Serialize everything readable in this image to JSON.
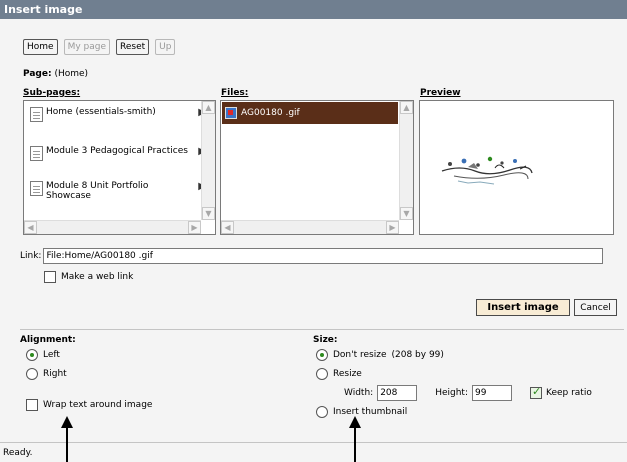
{
  "window": {
    "title": "Insert image"
  },
  "nav": {
    "home": "Home",
    "my_page": "My page",
    "reset": "Reset",
    "up": "Up"
  },
  "page": {
    "label": "Page:",
    "value": "(Home)"
  },
  "columns": {
    "subpages": "Sub-pages:",
    "files": "Files:",
    "preview": "Preview"
  },
  "subpages": [
    {
      "label": "Home (essentials-smith)"
    },
    {
      "label": "Module 3 Pedagogical Practices"
    },
    {
      "label": "Module 8 Unit Portfolio Showcase"
    }
  ],
  "files": {
    "selected": "AG00180 .gif"
  },
  "link": {
    "label": "Link:",
    "value": "File:Home/AG00180 .gif",
    "web_link_label": "Make a web link"
  },
  "buttons": {
    "insert": "Insert image",
    "cancel": "Cancel"
  },
  "alignment": {
    "title": "Alignment:",
    "left": "Left",
    "right": "Right",
    "wrap": "Wrap text around image",
    "selected": "Left"
  },
  "size": {
    "title": "Size:",
    "dont_resize": "Don't resize",
    "dont_resize_info": "(208 by 99)",
    "resize": "Resize",
    "width_label": "Width:",
    "width": "208",
    "height_label": "Height:",
    "height": "99",
    "keep_ratio": "Keep ratio",
    "keep_ratio_checked": true,
    "thumbnail": "Insert thumbnail",
    "selected": "Don't resize"
  },
  "status": "Ready."
}
